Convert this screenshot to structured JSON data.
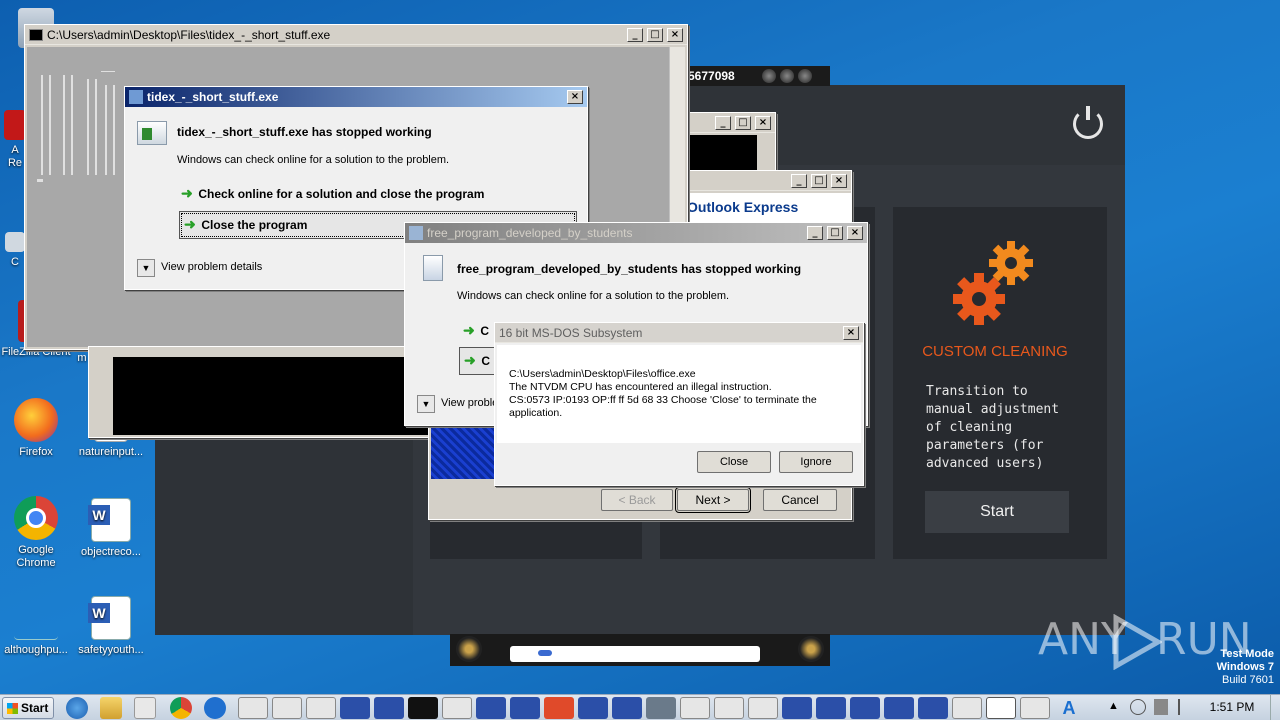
{
  "desktop": {
    "icons": [
      {
        "label": "Re"
      },
      {
        "label": "A\nRe"
      },
      {
        "label": "C"
      },
      {
        "label": "FileZilla Client"
      },
      {
        "label": "m"
      },
      {
        "label": "Firefox"
      },
      {
        "label": "natureinput..."
      },
      {
        "label": "Google\nChrome"
      },
      {
        "label": "objectreco..."
      },
      {
        "label": "althoughpu..."
      },
      {
        "label": "safetyyouth..."
      }
    ],
    "watermark": {
      "brand": "ANY",
      "brand2": "RUN",
      "line1": "Test Mode",
      "line2": "Windows 7",
      "line3": "Build 7601"
    }
  },
  "console_window": {
    "title": "C:\\Users\\admin\\Desktop\\Files\\tidex_-_short_stuff.exe"
  },
  "dialog_tidex": {
    "title": "tidex_-_short_stuff.exe",
    "heading": "tidex_-_short_stuff.exe has stopped working",
    "message": "Windows can check online for a solution to the problem.",
    "option1": "Check online for a solution and close the program",
    "option2": "Close the program",
    "details": "View problem details"
  },
  "dialog_free": {
    "title": "free_program_developed_by_students",
    "heading": "free_program_developed_by_students has stopped working",
    "message": "Windows can check online for a solution to the problem.",
    "option1": "C",
    "option2": "C",
    "details": "View proble"
  },
  "dialog_msdos": {
    "title": "16 bit MS-DOS Subsystem",
    "line1": "C:\\Users\\admin\\Desktop\\Files\\office.exe",
    "line2": "The NTVDM CPU has encountered an illegal instruction.",
    "line3": "CS:0573 IP:0193 OP:ff ff 5d 68 33 Choose 'Close' to terminate the",
    "line4": "application.",
    "close_label": "Close",
    "ignore_label": "Ignore"
  },
  "wizard": {
    "back_label": "< Back",
    "next_label": "Next >",
    "cancel_label": "Cancel"
  },
  "outlook_window": {
    "title_fragment": "Outlook Express"
  },
  "media_player": {
    "counter": "5677098"
  },
  "cleaner": {
    "card_title": "CUSTOM CLEANING",
    "card_text": "Transition to manual adjustment of cleaning parameters (for advanced users)",
    "start_label": "Start",
    "accent_color": "#e8581c"
  },
  "taskbar": {
    "start_label": "Start",
    "clock": "1:51 PM"
  }
}
